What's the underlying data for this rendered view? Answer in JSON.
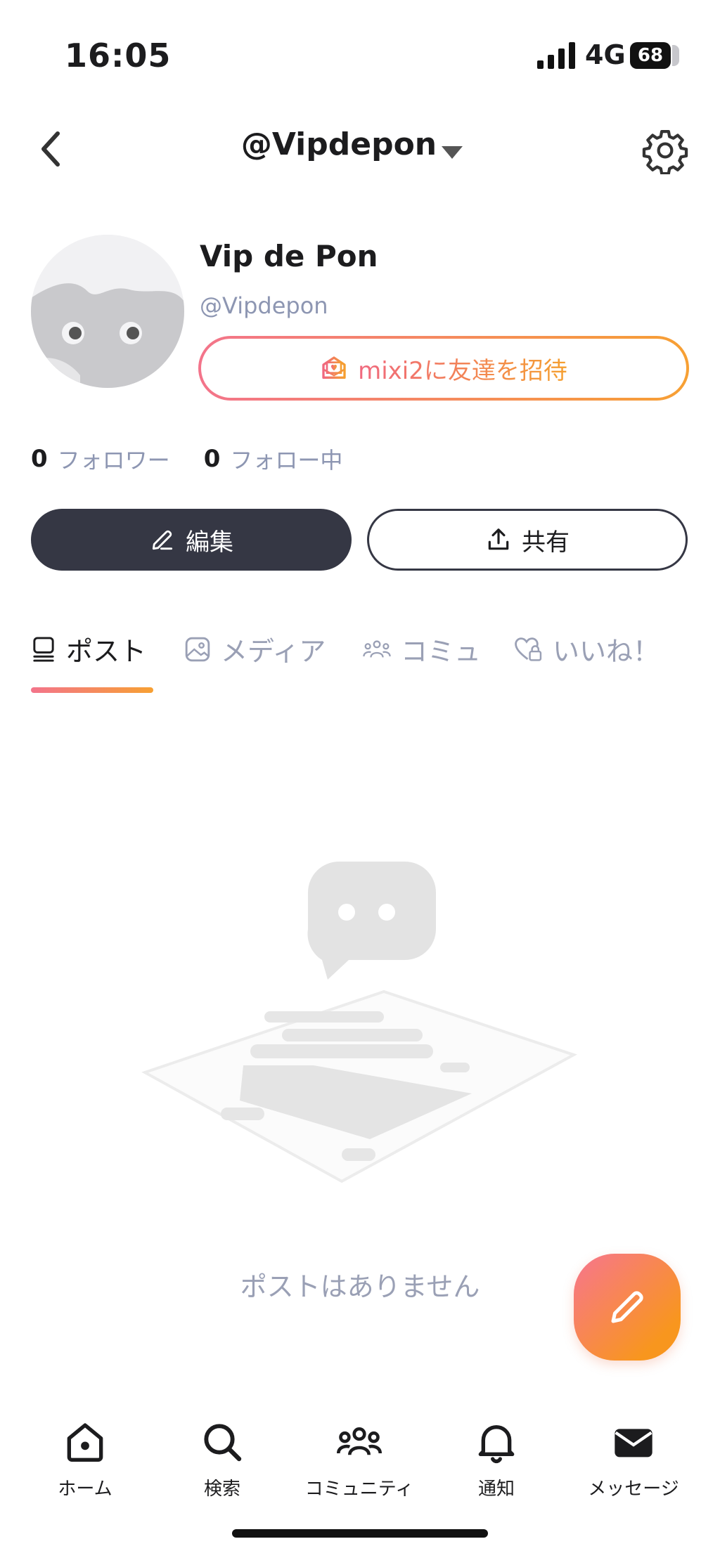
{
  "status_bar": {
    "time": "16:05",
    "network": "4G",
    "battery": "68"
  },
  "header": {
    "username": "@Vipdepon"
  },
  "profile": {
    "display_name": "Vip de Pon",
    "handle": "@Vipdepon",
    "invite_label": "mixi2に友達を招待",
    "followers_count": "0",
    "followers_label": "フォロワー",
    "following_count": "0",
    "following_label": "フォロー中"
  },
  "actions": {
    "edit_label": "編集",
    "share_label": "共有"
  },
  "tabs": [
    {
      "label": "ポスト",
      "icon": "posts-icon",
      "active": true
    },
    {
      "label": "メディア",
      "icon": "media-icon",
      "active": false
    },
    {
      "label": "コミュ",
      "icon": "community-icon",
      "active": false
    },
    {
      "label": "いいね！",
      "icon": "like-lock-icon",
      "active": false
    }
  ],
  "empty_state": {
    "message": "ポストはありません"
  },
  "bottom_nav": [
    {
      "label": "ホーム",
      "icon": "home-icon"
    },
    {
      "label": "検索",
      "icon": "search-icon"
    },
    {
      "label": "コミュニティ",
      "icon": "community-icon"
    },
    {
      "label": "通知",
      "icon": "bell-icon"
    },
    {
      "label": "メッセージ",
      "icon": "mail-icon"
    }
  ],
  "colors": {
    "accent_start": "#f3748b",
    "accent_end": "#f7a033",
    "dark": "#353744",
    "muted": "#8d96b2"
  }
}
